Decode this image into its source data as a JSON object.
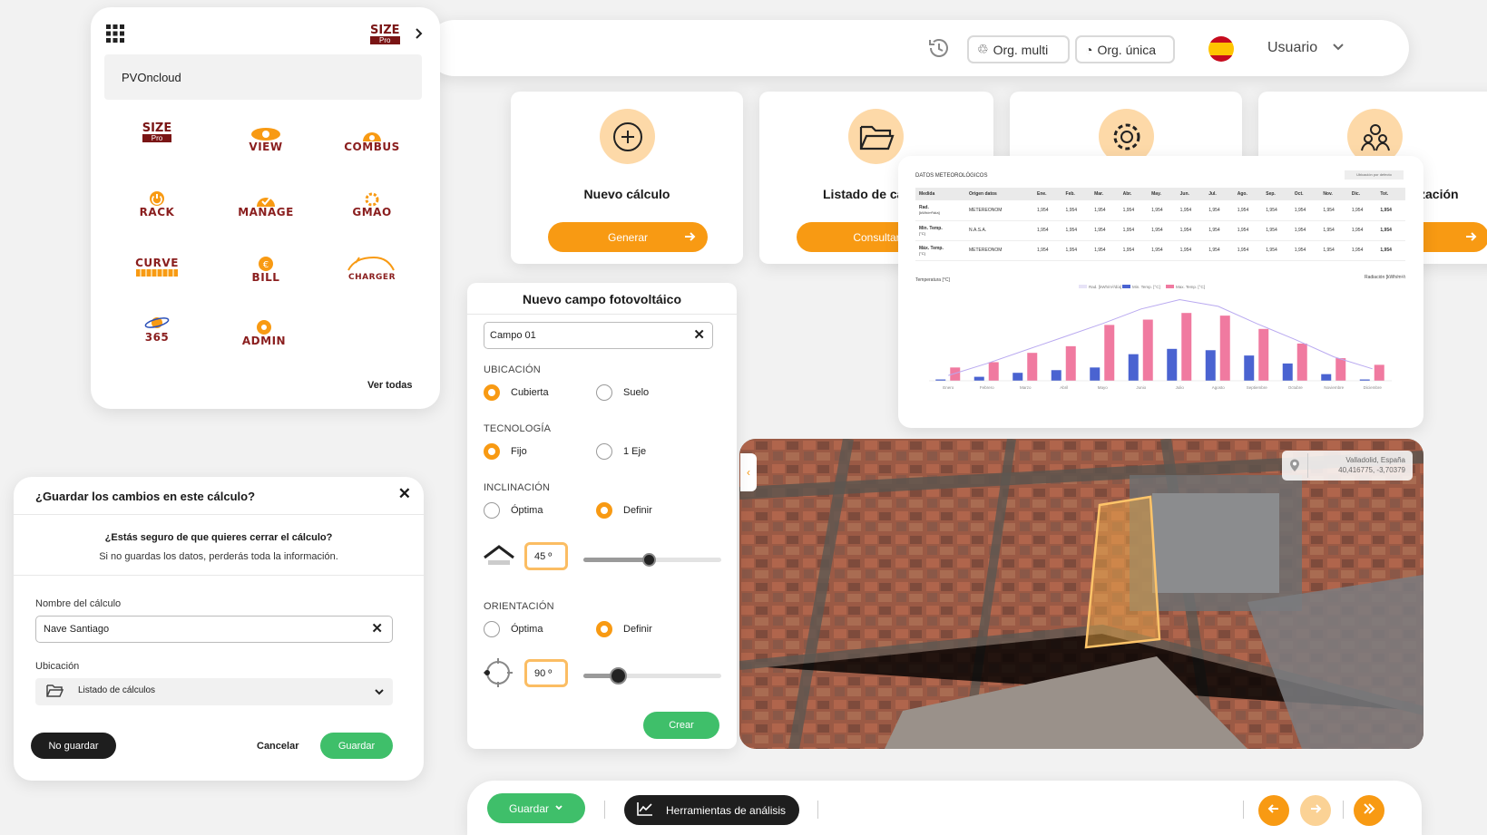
{
  "topbar": {
    "org_multi": "Org. multi",
    "org_unica": "Org. única",
    "user": "Usuario"
  },
  "apps_panel": {
    "logo_size": "SIZE",
    "logo_pro": "Pro",
    "account": "PVOncloud",
    "apps": [
      "SIZE Pro",
      "VIEW",
      "COMBUS",
      "RACK",
      "MANAGE",
      "GMAO",
      "CURVE",
      "BILL",
      "CHARGER",
      "365",
      "ADMIN"
    ],
    "ver_todas": "Ver todas"
  },
  "cards": [
    {
      "title": "Nuevo cálculo",
      "button": "Generar",
      "icon": "plus-circle-icon"
    },
    {
      "title": "Listado de cá",
      "button": "Consultar",
      "icon": "folder-open-icon"
    },
    {
      "title": "",
      "button": "",
      "icon": "gear-icon"
    },
    {
      "title": "zación",
      "button": "",
      "icon": "users-icon"
    }
  ],
  "weather": {
    "title": "DATOS METEOROLÓGICOS",
    "badge": "Ubicación por defecto",
    "headers": [
      "Medida",
      "Origen datos",
      "Ene.",
      "Feb.",
      "Mar.",
      "Abr.",
      "May.",
      "Jun.",
      "Jul.",
      "Ago.",
      "Sep.",
      "Oct.",
      "Nov.",
      "Dic.",
      "Tot."
    ],
    "rows": [
      {
        "measure": "Rad.",
        "unit": "[kWh/m²/día]",
        "source": "METEREONOM",
        "val": "1,954"
      },
      {
        "measure": "Min. Temp.",
        "unit": "[°C]",
        "source": "N.A.S.A.",
        "val": "1,954"
      },
      {
        "measure": "Máx. Temp.",
        "unit": "[°C]",
        "source": "METEREONOM",
        "val": "1,954"
      }
    ]
  },
  "chart_data": {
    "type": "bar",
    "ylabel_left": "Temperatura [°C]",
    "ylabel_right": "Radiación [kWh/m²/día]",
    "legend": [
      "Rad. [kWh/m²/día]",
      "Min. Temp. [°C]",
      "Max. Temp. [°C]"
    ],
    "categories": [
      "Enero",
      "Febrero",
      "Marzo",
      "Abril",
      "Mayo",
      "Junio",
      "Julio",
      "Agosto",
      "Septiembre",
      "Octubre",
      "Noviembre",
      "Diciembre"
    ],
    "series": [
      {
        "name": "Min. Temp. [°C]",
        "color": "#4a63d1",
        "values": [
          1,
          3,
          6,
          8,
          10,
          20,
          24,
          23,
          19,
          13,
          5,
          1
        ]
      },
      {
        "name": "Max. Temp. [°C]",
        "color": "#f07aa0",
        "values": [
          10,
          14,
          21,
          26,
          42,
          46,
          51,
          49,
          39,
          28,
          17,
          12
        ]
      },
      {
        "name": "Rad. [kWh/m²/día]",
        "color": "#b9a9f0",
        "values": [
          4,
          13,
          23,
          33,
          43,
          54,
          61,
          56,
          43,
          31,
          18,
          9
        ]
      }
    ],
    "ylim": [
      0,
      60
    ]
  },
  "campo": {
    "title": "Nuevo campo fotovoltáico",
    "name_value": "Campo 01",
    "ubicacion": "UBICACIÓN",
    "ubi_opts": [
      "Cubierta",
      "Suelo"
    ],
    "tecnologia": "TECNOLOGÍA",
    "tec_opts": [
      "Fijo",
      "1 Eje"
    ],
    "inclinacion": "INCLINACIÓN",
    "inc_opts": [
      "Óptima",
      "Definir"
    ],
    "inc_value": "45 º",
    "inc_level": 0.48,
    "orientacion": "ORIENTACIÓN",
    "ori_opts": [
      "Óptima",
      "Definir"
    ],
    "ori_value": "90 º",
    "ori_level": 0.25,
    "crear": "Crear"
  },
  "map": {
    "city": "Valladolid, España",
    "coords": "40,416775, -3,70379"
  },
  "dialog": {
    "title": "¿Guardar los cambios en este cálculo?",
    "question": "¿Estás seguro de que quieres cerrar el cálculo?",
    "warning": "Si no guardas los datos, perderás toda la información.",
    "name_label": "Nombre del cálculo",
    "name_value": "Nave Santiago",
    "loc_label": "Ubicación",
    "loc_value": "Listado de cálculos",
    "no_guardar": "No guardar",
    "cancelar": "Cancelar",
    "guardar": "Guardar"
  },
  "bottombar": {
    "guardar": "Guardar",
    "tools": "Herramientas de análisis"
  }
}
